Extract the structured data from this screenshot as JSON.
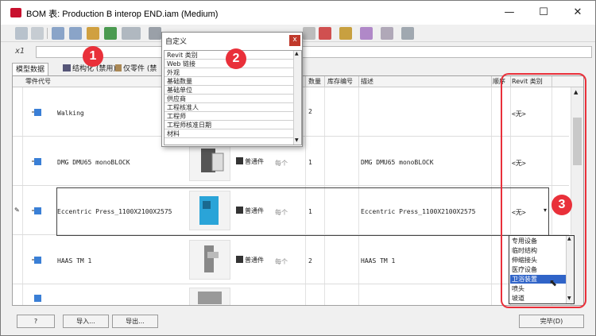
{
  "window": {
    "title": "BOM 表: Production B interop END.iam (Medium)",
    "minimize": "—",
    "maximize": "☐",
    "close": "✕"
  },
  "formula": {
    "fx": "x1"
  },
  "tabs": [
    {
      "label": "模型数据"
    },
    {
      "label": "结构化 (禁用)"
    },
    {
      "label": "仅零件 (禁"
    }
  ],
  "columns": {
    "part_number": "零件代号",
    "qty": "数量",
    "stock": "库存编号",
    "desc": "描述",
    "seq": "顺序",
    "revit": "Revit 类别"
  },
  "rows": [
    {
      "name": "Walking",
      "type": "",
      "unit": "",
      "qty": "2",
      "desc": "",
      "revit": ""
    },
    {
      "name": "DMG DMU65 monoBLOCK",
      "type": "普通件",
      "unit": "每个",
      "qty": "1",
      "desc": "DMG DMU65 monoBLOCK",
      "revit": "<无>"
    },
    {
      "name": "Eccentric Press_1100X2100X2575",
      "type": "普通件",
      "unit": "每个",
      "qty": "1",
      "desc": "Eccentric Press_1100X2100X2575",
      "revit": "<无>"
    },
    {
      "name": "HAAS TM 1",
      "type": "普通件",
      "unit": "每个",
      "qty": "2",
      "desc": "HAAS TM 1",
      "revit": "<无>"
    }
  ],
  "walking_revit": "<无>",
  "custom_dialog": {
    "title": "自定义",
    "close": "x",
    "items": [
      "Revit 类别",
      "Web 链接",
      "外观",
      "基础数量",
      "基础单位",
      "供应商",
      "工程核准人",
      "工程师",
      "工程师核准日期",
      "材料"
    ]
  },
  "dropdown": {
    "items": [
      "专用设备",
      "临时结构",
      "伸缩接头",
      "医疗设备",
      "卫浴装置",
      "喷头",
      "坡道"
    ],
    "selected_index": 4
  },
  "badges": [
    "1",
    "2",
    "3"
  ],
  "buttons": {
    "help": "?",
    "import": "导入...",
    "export": "导出...",
    "done": "完毕(D)"
  },
  "colors": {
    "accent": "#e9303a",
    "selection": "#3064c8"
  }
}
